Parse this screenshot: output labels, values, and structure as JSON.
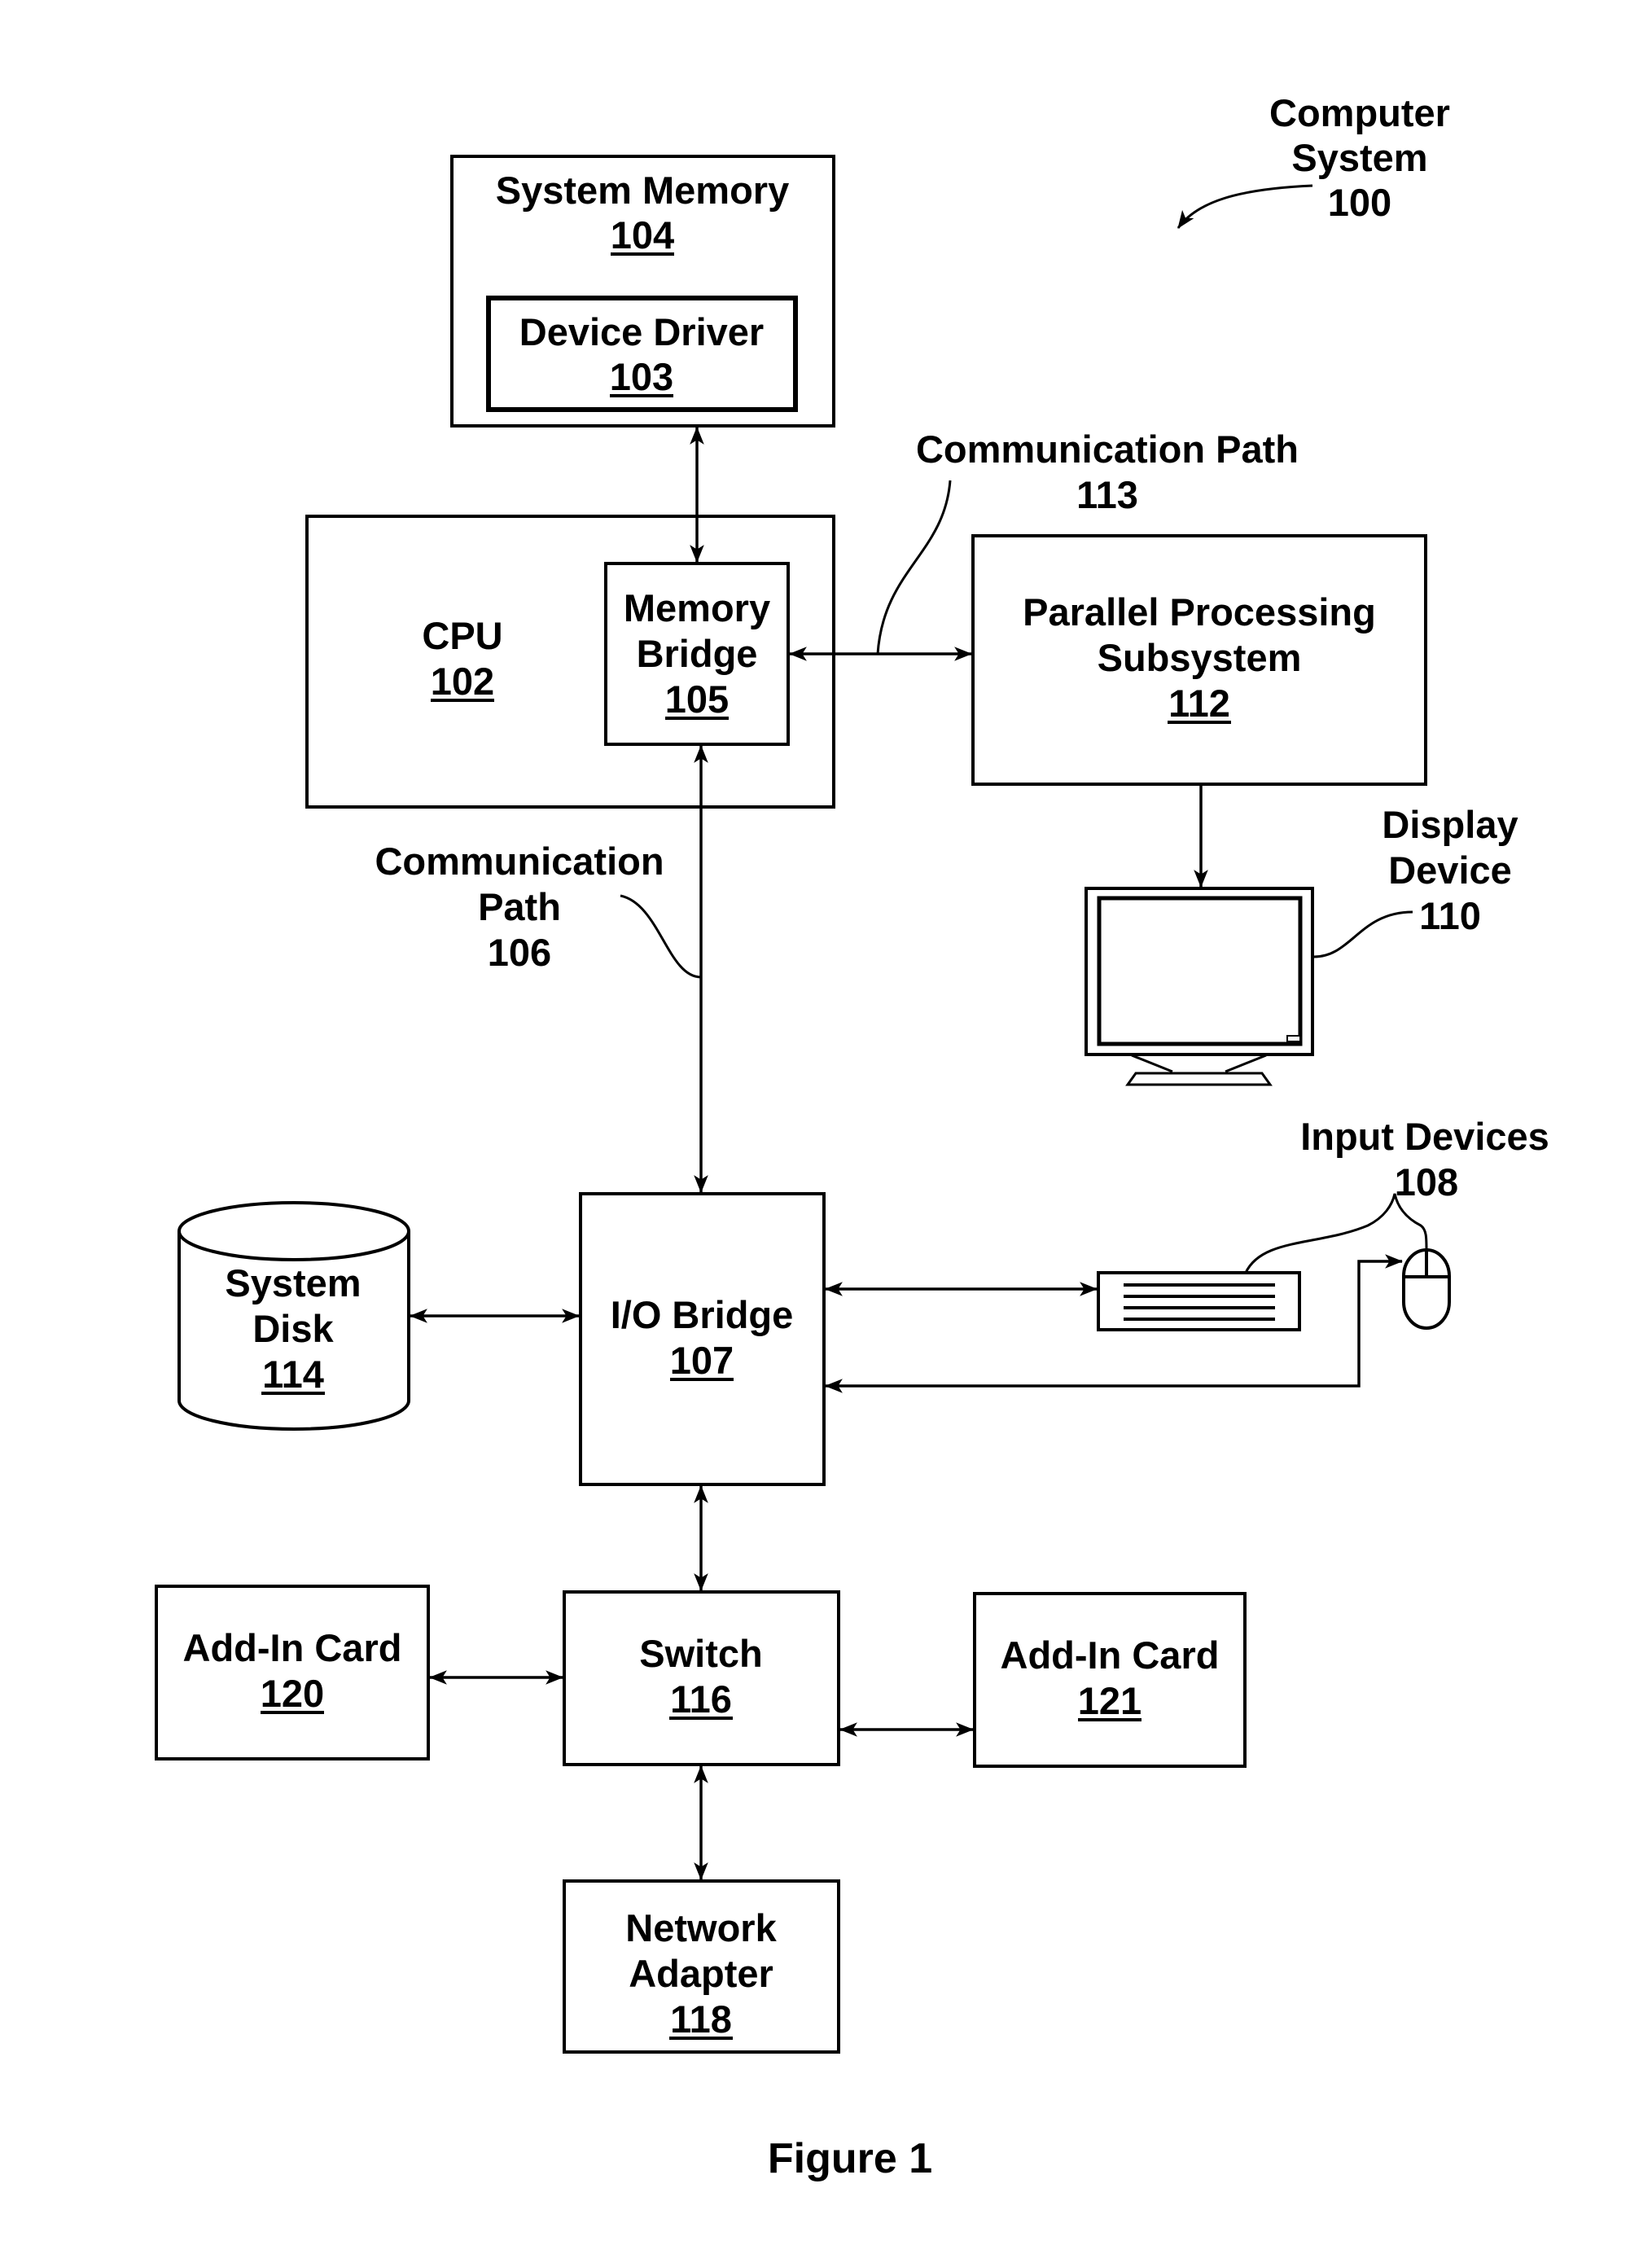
{
  "figure": {
    "caption": "Figure 1",
    "system_label": [
      "Computer",
      "System",
      "100"
    ]
  },
  "components": {
    "system_memory": {
      "name": "System Memory",
      "ref": "104"
    },
    "device_driver": {
      "name": "Device Driver",
      "ref": "103"
    },
    "cpu": {
      "name": "CPU",
      "ref": "102"
    },
    "memory_bridge": {
      "name_lines": [
        "Memory",
        "Bridge"
      ],
      "ref": "105"
    },
    "parallel_processing": {
      "name_lines": [
        "Parallel Processing",
        "Subsystem"
      ],
      "ref": "112"
    },
    "display_device": {
      "name_lines": [
        "Display",
        "Device"
      ],
      "ref": "110"
    },
    "io_bridge": {
      "name": "I/O Bridge",
      "ref": "107"
    },
    "system_disk": {
      "name_lines": [
        "System",
        "Disk"
      ],
      "ref": "114"
    },
    "input_devices": {
      "name": "Input Devices",
      "ref": "108"
    },
    "add_in_card_120": {
      "name": "Add-In Card",
      "ref": "120"
    },
    "switch": {
      "name": "Switch",
      "ref": "116"
    },
    "add_in_card_121": {
      "name": "Add-In Card",
      "ref": "121"
    },
    "network_adapter": {
      "name_lines": [
        "Network",
        "Adapter"
      ],
      "ref": "118"
    }
  },
  "paths": {
    "comm_path_113": {
      "name": "Communication Path",
      "ref": "113"
    },
    "comm_path_106": {
      "name_lines": [
        "Communication",
        "Path"
      ],
      "ref": "106"
    }
  }
}
